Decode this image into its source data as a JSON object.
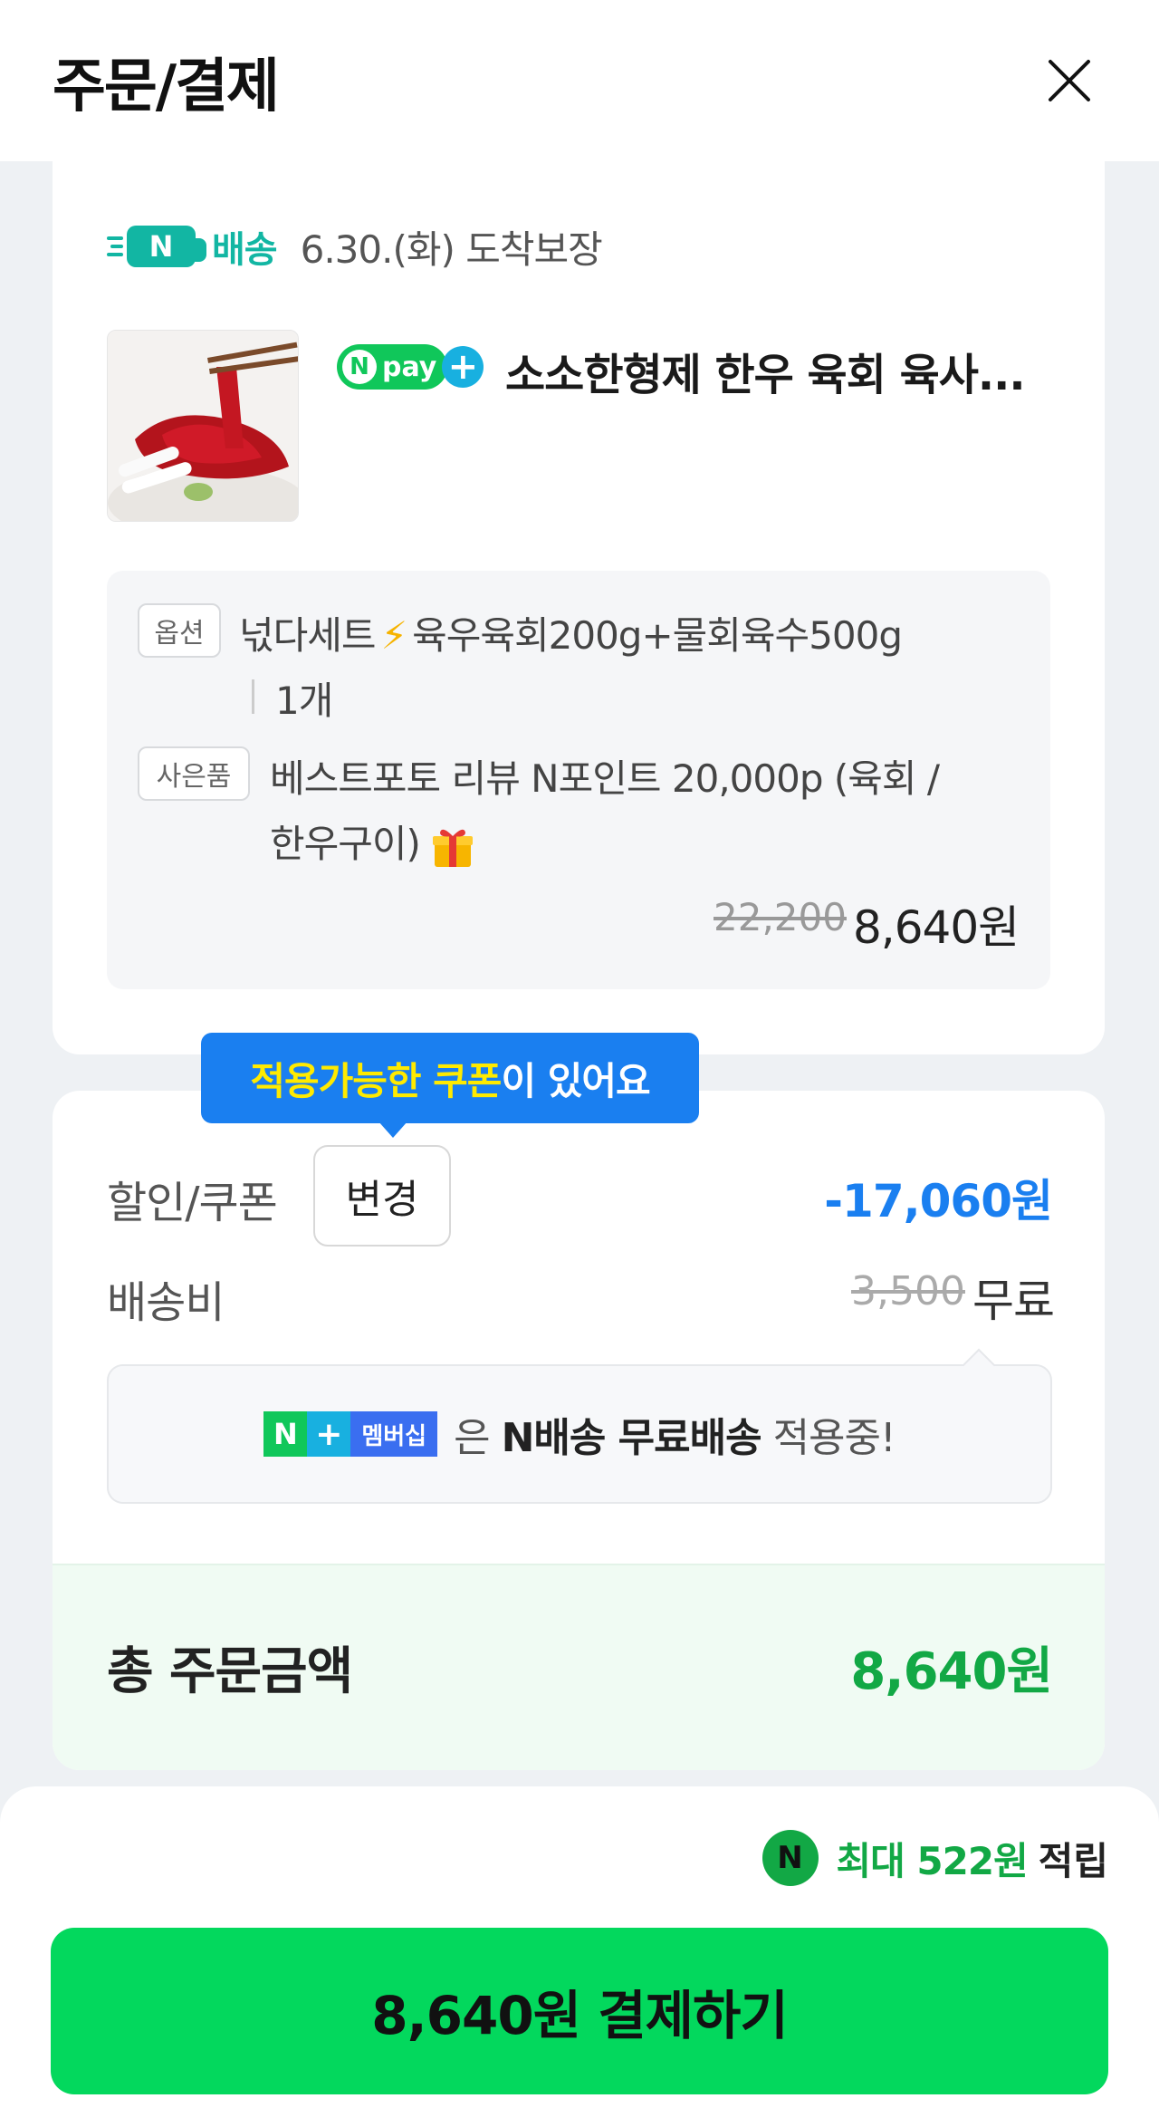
{
  "header": {
    "title": "주문/결제",
    "close_icon": "close-icon"
  },
  "shipping": {
    "badge_letter": "N",
    "badge_label": "배송",
    "arrival": "6.30.(화) 도착보장",
    "brand_color": "#12b6a3"
  },
  "product": {
    "npay_letter": "N",
    "npay_label": "pay",
    "npay_plus": "+",
    "name": "소소한형제 한우 육회 육사...",
    "image_icon": "beef-tartare-photo"
  },
  "options": {
    "option_tag": "옵션",
    "option_name_1": "넋다세트",
    "option_name_2": "육우육회200g+물회육수500g",
    "quantity": "1개",
    "gift_tag": "사은품",
    "gift_line_1": "베스트포토 리뷰 N포인트 20,000p (육회 /",
    "gift_line_2": "한우구이)",
    "original_price": "22,200",
    "price": "8,640원"
  },
  "coupon_tooltip": {
    "highlight": "적용가능한 쿠폰",
    "rest": "이 있어요"
  },
  "discount": {
    "label": "할인/쿠폰",
    "change_button": "변경",
    "value": "-17,060원"
  },
  "delivery_fee": {
    "label": "배송비",
    "original": "3,500",
    "value": "무료"
  },
  "membership": {
    "badge_n": "N",
    "badge_plus": "+",
    "badge_label": "멤버십",
    "text_1": "은 ",
    "text_bold": "N배송 무료배송",
    "text_2": " 적용중!"
  },
  "total": {
    "label": "총 주문금액",
    "value": "8,640원"
  },
  "reward": {
    "coin": "N",
    "amount": "최대 522원",
    "suffix": "적립"
  },
  "pay_button": {
    "label": "8,640원 결제하기"
  },
  "colors": {
    "accent_green": "#03d85d",
    "total_green": "#12a845",
    "discount_blue": "#1a7ff0",
    "background": "#eef1f4"
  }
}
